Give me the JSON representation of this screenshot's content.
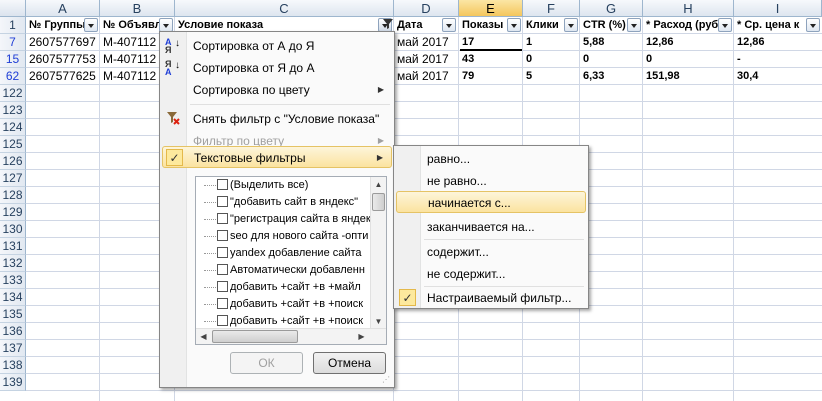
{
  "columns": [
    "A",
    "B",
    "C",
    "D",
    "E",
    "F",
    "G",
    "H",
    "I"
  ],
  "row_numbers": [
    "1",
    "7",
    "15",
    "62",
    "122",
    "123",
    "124",
    "125",
    "126",
    "127",
    "128",
    "129",
    "130",
    "131",
    "132",
    "133",
    "134",
    "135",
    "136",
    "137",
    "138",
    "139"
  ],
  "header_row": [
    "№ Группы",
    "№ Объявл",
    "Условие показа",
    "Дата",
    "Показы",
    "Клики",
    "CTR (%)",
    "* Расход (руб",
    "* Ср. цена к"
  ],
  "data_rows": [
    [
      "2607577697",
      "M-407112",
      "",
      "май 2017",
      "17",
      "1",
      "5,88",
      "12,86",
      "12,86"
    ],
    [
      "2607577753",
      "M-407112",
      "",
      "май 2017",
      "43",
      "0",
      "0",
      "0",
      "-"
    ],
    [
      "2607577625",
      "M-407112",
      "",
      "май 2017",
      "79",
      "5",
      "6,33",
      "151,98",
      "30,4"
    ]
  ],
  "filter_menu": {
    "sort_asc": "Сортировка от А до Я",
    "sort_desc": "Сортировка от Я до А",
    "sort_color": "Сортировка по цвету",
    "clear_filter": "Снять фильтр с \"Условие показа\"",
    "filter_color": "Фильтр по цвету",
    "text_filters": "Текстовые фильтры",
    "list_items": [
      "(Выделить все)",
      "\"добавить сайт в яндекс\"",
      "\"регистрация сайта в яндекс",
      "seo для нового сайта -опти",
      "yandex добавление сайта",
      "Автоматически добавленн",
      "добавить +сайт +в +майл",
      "добавить +сайт +в +поиск",
      "добавить +сайт +в +поиск"
    ],
    "ok_label": "ОК",
    "cancel_label": "Отмена",
    "sort_icon_top": "А\nЯ",
    "sort_icon_bottom": "Я\nА"
  },
  "text_filter_submenu": {
    "items": [
      "равно...",
      "не равно...",
      "начинается с...",
      "заканчивается на...",
      "содержит...",
      "не содержит...",
      "Настраиваемый фильтр..."
    ]
  },
  "checkmark": "✓"
}
